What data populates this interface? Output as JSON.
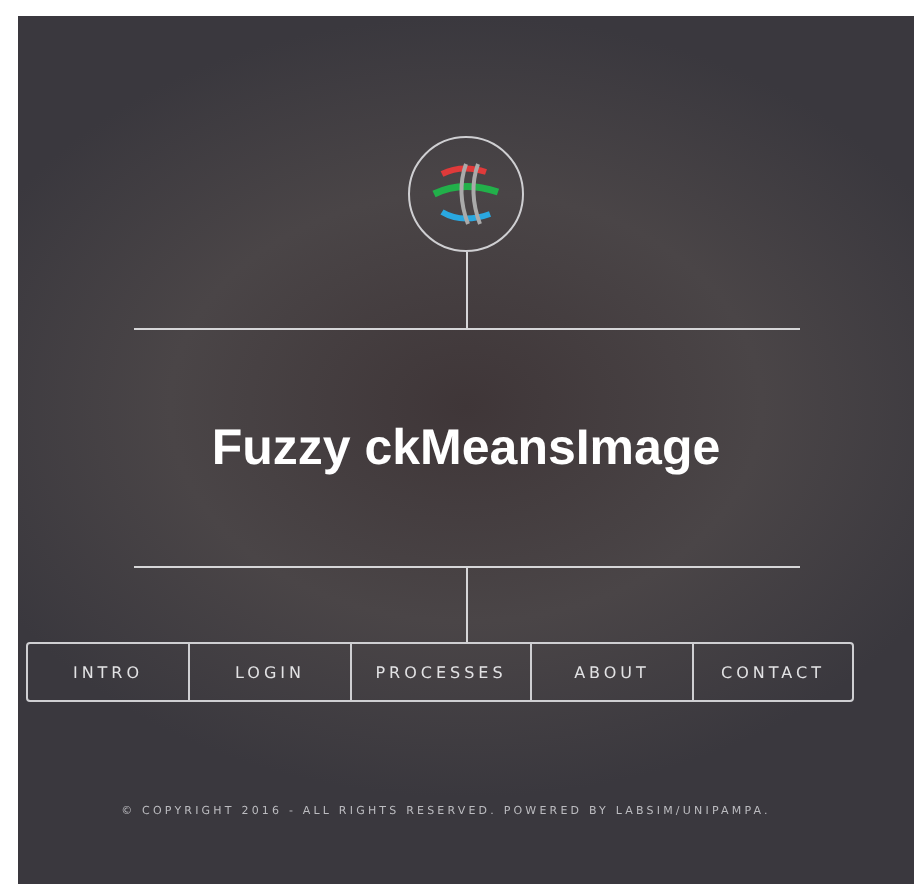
{
  "title": "Fuzzy ckMeansImage",
  "nav": [
    {
      "label": "INTRO"
    },
    {
      "label": "LOGIN"
    },
    {
      "label": "PROCESSES"
    },
    {
      "label": "ABOUT"
    },
    {
      "label": "CONTACT"
    }
  ],
  "footer": "© COPYRIGHT 2016 - ALL RIGHTS RESERVED. POWERED BY LABSIM/UNIPAMPA."
}
